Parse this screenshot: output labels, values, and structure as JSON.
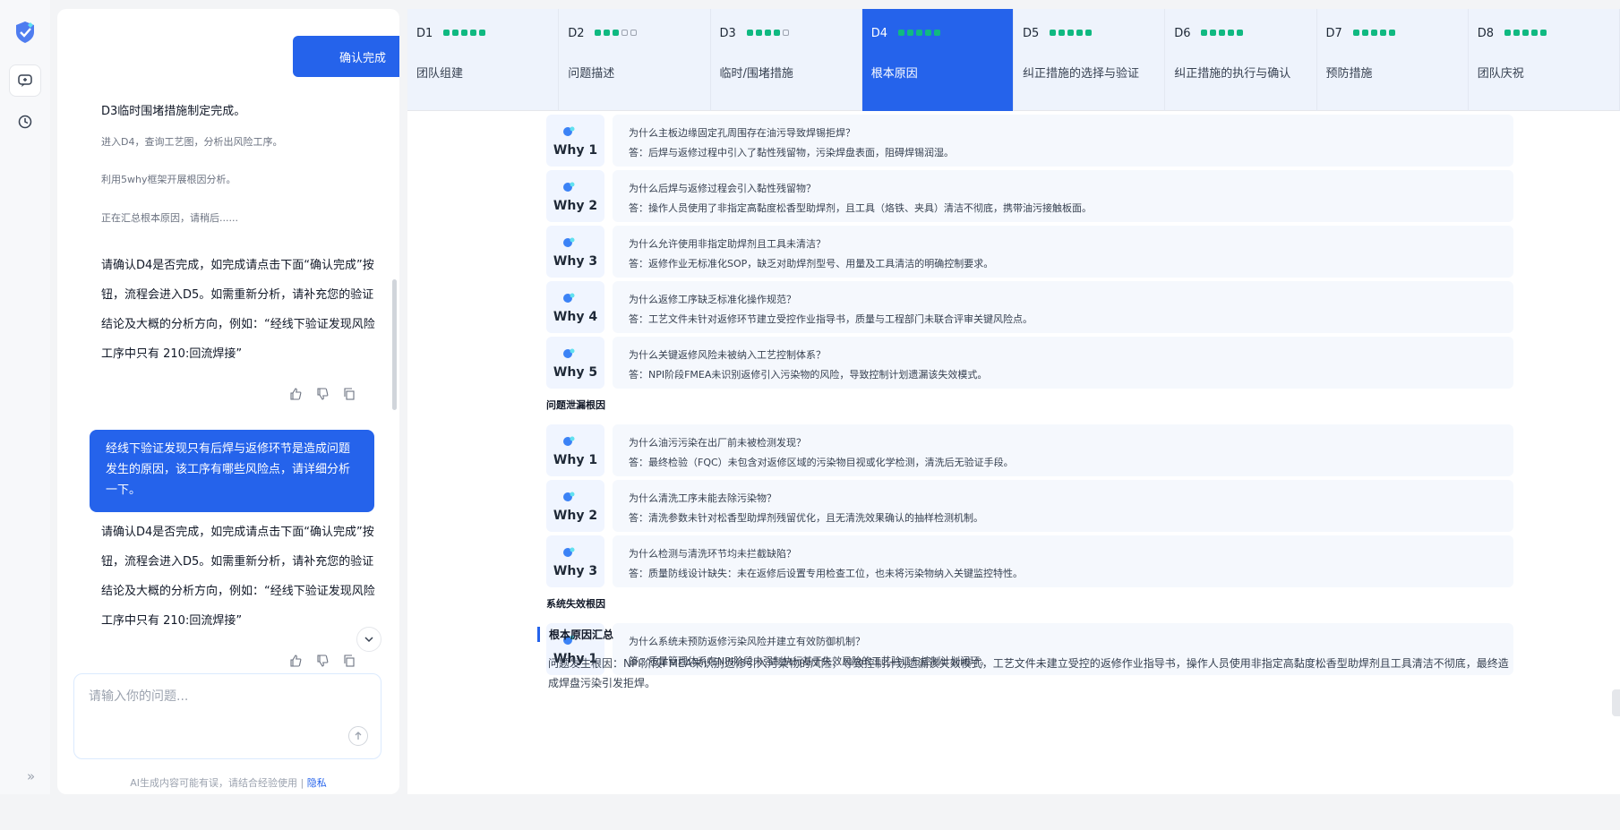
{
  "rail": {
    "expand_icon": "»"
  },
  "chat": {
    "confirm_button": "确认完成",
    "d3_done": "D3临时围堵措施制定完成。",
    "progress": [
      "进入D4，查询工艺图，分析出风险工序。",
      "利用5why框架开展根因分析。",
      "正在汇总根本原因，请稍后......"
    ],
    "confirm_prompt_1": "请确认D4是否完成，如完成请点击下面“确认完成”按钮，流程会进入D5。如需重新分析，请补充您的验证结论及大概的分析方向，例如：“经线下验证发现风险工序中只有 210:回流焊接”",
    "user_message": "经线下验证发现只有后焊与返修环节是造成问题发生的原因，该工序有哪些风险点，请详细分析一下。",
    "confirm_prompt_2": "请确认D4是否完成，如完成请点击下面“确认完成”按钮，流程会进入D5。如需重新分析，请补充您的验证结论及大概的分析方向，例如：“经线下验证发现风险工序中只有 210:回流焊接”",
    "input_placeholder": "请输入你的问题...",
    "disclaimer": "AI生成内容可能有误，请结合经验使用",
    "disclaimer_sep": "|",
    "privacy_link": "隐私"
  },
  "steps": [
    {
      "code": "D1",
      "name": "团队组建",
      "filled": 5,
      "active": false
    },
    {
      "code": "D2",
      "name": "问题描述",
      "filled": 3,
      "active": false
    },
    {
      "code": "D3",
      "name": "临时/围堵措施",
      "filled": 4,
      "active": false
    },
    {
      "code": "D4",
      "name": "根本原因",
      "filled": 5,
      "active": true
    },
    {
      "code": "D5",
      "name": "纠正措施的选择与验证",
      "filled": 5,
      "active": false
    },
    {
      "code": "D6",
      "name": "纠正措施的执行与确认",
      "filled": 5,
      "active": false
    },
    {
      "code": "D7",
      "name": "预防措施",
      "filled": 5,
      "active": false
    },
    {
      "code": "D8",
      "name": "团队庆祝",
      "filled": 5,
      "active": false
    }
  ],
  "groups": [
    {
      "title": "",
      "whys": [
        {
          "label": "Why 1",
          "q": "为什么主板边缘固定孔周围存在油污导致焊锡拒焊？",
          "a": "答：后焊与返修过程中引入了黏性残留物，污染焊盘表面，阻碍焊锡润湿。"
        },
        {
          "label": "Why 2",
          "q": "为什么后焊与返修过程会引入黏性残留物？",
          "a": "答：操作人员使用了非指定高黏度松香型助焊剂，且工具（烙铁、夹具）清洁不彻底，携带油污接触板面。"
        },
        {
          "label": "Why 3",
          "q": "为什么允许使用非指定助焊剂且工具未清洁？",
          "a": "答：返修作业无标准化SOP，缺乏对助焊剂型号、用量及工具清洁的明确控制要求。"
        },
        {
          "label": "Why 4",
          "q": "为什么返修工序缺乏标准化操作规范？",
          "a": "答：工艺文件未针对返修环节建立受控作业指导书，质量与工程部门未联合评审关键风险点。"
        },
        {
          "label": "Why 5",
          "q": "为什么关键返修风险未被纳入工艺控制体系？",
          "a": "答：NPI阶段FMEA未识别返修引入污染物的风险，导致控制计划遗漏该失效模式。"
        }
      ]
    },
    {
      "title": "问题泄漏根因",
      "whys": [
        {
          "label": "Why 1",
          "q": "为什么油污污染在出厂前未被检测发现？",
          "a": "答：最终检验（FQC）未包含对返修区域的污染物目视或化学检测，清洗后无验证手段。"
        },
        {
          "label": "Why 2",
          "q": "为什么清洗工序未能去除污染物？",
          "a": "答：清洗参数未针对松香型助焊剂残留优化，且无清洗效果确认的抽样检测机制。"
        },
        {
          "label": "Why 3",
          "q": "为什么检测与清洗环节均未拦截缺陷？",
          "a": "答：质量防线设计缺失：未在返修后设置专用检查工位，也未将污染物纳入关键监控特性。"
        }
      ]
    },
    {
      "title": "系统失效根因",
      "whys": [
        {
          "label": "Why 1",
          "q": "为什么系统未预防返修污染风险并建立有效防御机制？",
          "a": "答：质量管理体系在NPI阶段未强制执行基于失效风险的工艺验证与控制计划闭环。"
        }
      ]
    }
  ],
  "summary": {
    "title": "根本原因汇总",
    "text": "问题发生根因：NPI阶段FMEA未识别返修引入污染物的风险，导致控制计划遗漏该失效模式，工艺文件未建立受控的返修作业指导书，操作人员使用非指定高黏度松香型助焊剂且工具清洁不彻底，最终造成焊盘污染引发拒焊。"
  },
  "colors": {
    "accent": "#2563eb",
    "dot_on": "#10b981",
    "card_bg": "#f5f8fd"
  }
}
